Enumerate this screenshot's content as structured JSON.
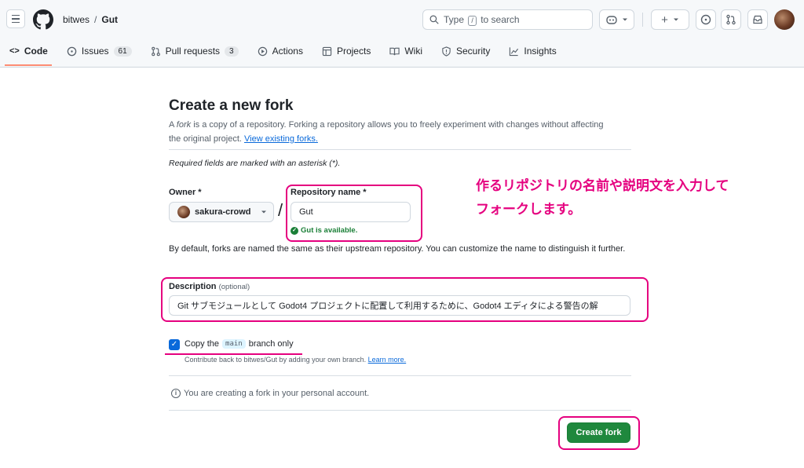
{
  "header": {
    "owner": "bitwes",
    "separator": "/",
    "repo": "Gut",
    "search_prefix": "Type",
    "search_key": "/",
    "search_suffix": "to search"
  },
  "tabs": [
    {
      "label": "Code",
      "icon": "code-icon"
    },
    {
      "label": "Issues",
      "icon": "issue-icon",
      "count": "61"
    },
    {
      "label": "Pull requests",
      "icon": "pull-request-icon",
      "count": "3"
    },
    {
      "label": "Actions",
      "icon": "play-icon"
    },
    {
      "label": "Projects",
      "icon": "table-icon"
    },
    {
      "label": "Wiki",
      "icon": "book-icon"
    },
    {
      "label": "Security",
      "icon": "shield-icon"
    },
    {
      "label": "Insights",
      "icon": "graph-icon"
    }
  ],
  "form": {
    "title": "Create a new fork",
    "desc_a": "A ",
    "desc_fork": "fork",
    "desc_b": " is a copy of a repository. Forking a repository allows you to freely experiment with changes without affecting the original project. ",
    "desc_link": "View existing forks.",
    "required_note": "Required fields are marked with an asterisk (*).",
    "owner_label": "Owner *",
    "owner_value": "sakura-crowd",
    "slash": "/",
    "repo_label": "Repository name *",
    "repo_value": "Gut",
    "available": "Gut is available.",
    "default_note": "By default, forks are named the same as their upstream repository. You can customize the name to distinguish it further.",
    "description_label": "Description",
    "description_optional": "(optional)",
    "description_value": "Git サブモジュールとして Godot4 プロジェクトに配置して利用するために、Godot4 エディタによる警告の解",
    "copy_prefix": "Copy the",
    "copy_branch": "main",
    "copy_suffix": "branch only",
    "copy_checked": true,
    "copy_sub": "Contribute back to bitwes/Gut by adding your own branch.",
    "copy_sub_link": "Learn more.",
    "info_text": "You are creating a fork in your personal account.",
    "create_button": "Create fork"
  },
  "annotation": {
    "line1": "作るリポジトリの名前や説明文を入力して",
    "line2": "フォークします。",
    "color": "#e5007f"
  },
  "colors": {
    "primary_button": "#1f883d",
    "link": "#0969da",
    "success": "#1a7f37",
    "tab_underline": "#fd8c73"
  }
}
